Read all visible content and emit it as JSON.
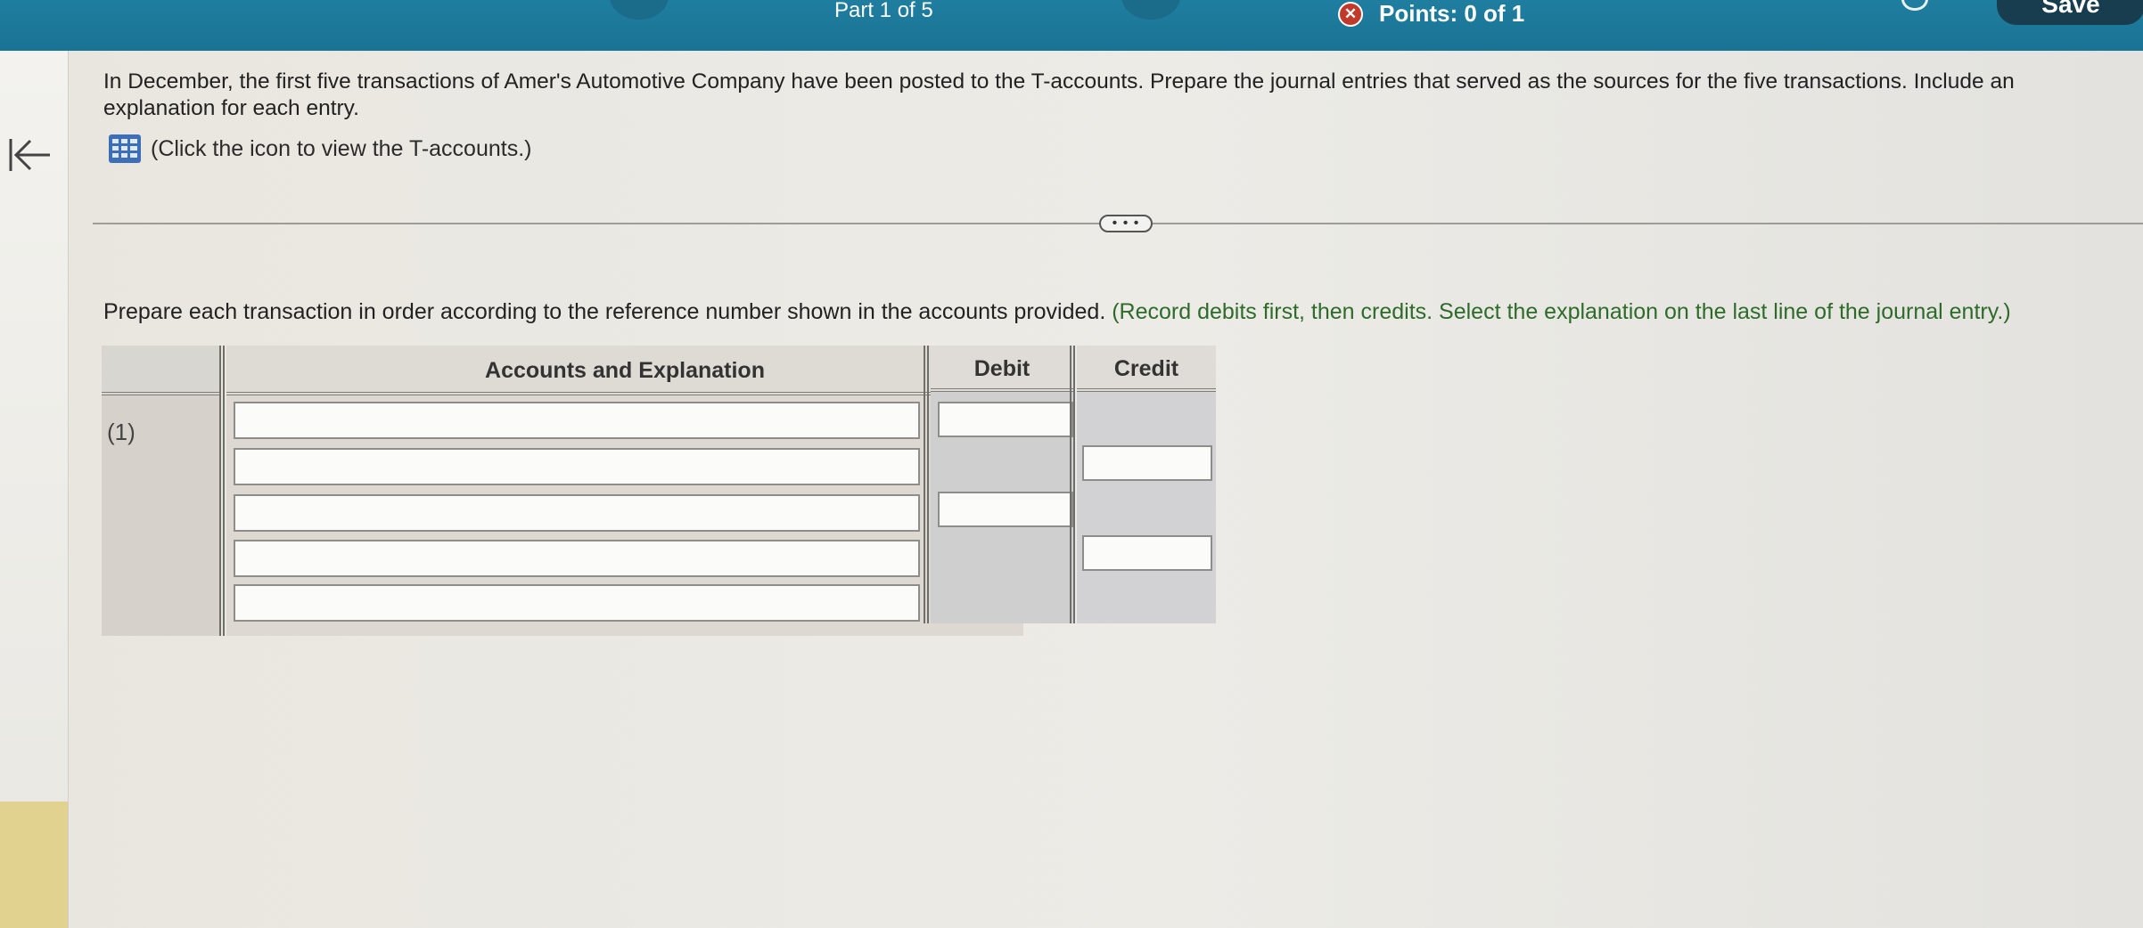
{
  "topbar": {
    "part_label": "Part 1 of 5",
    "points_label": "Points: 0 of 1",
    "save_label": "Save",
    "colors": {
      "bar": "#1f7ea0",
      "save_button": "#173d4f",
      "error_icon": "#c0392b"
    }
  },
  "question": {
    "text": "In December, the first five transactions of Amer's Automotive Company have been posted to the T-accounts. Prepare the journal entries that served as the sources for the five transactions. Include an explanation for each entry.",
    "link_text": "(Click the icon to view the T-accounts.)",
    "more_label": "• • •"
  },
  "instructions": {
    "main": "Prepare each transaction in order according to the reference number shown in the accounts provided.",
    "hint": "(Record debits first, then credits. Select the explanation on the last line of the journal entry.)"
  },
  "journal": {
    "headers": {
      "accounts": "Accounts and Explanation",
      "debit": "Debit",
      "credit": "Credit"
    },
    "entry_ref": "(1)",
    "account_rows": [
      "",
      "",
      "",
      "",
      ""
    ],
    "debit_inputs": [
      "",
      ""
    ],
    "credit_inputs": [
      "",
      ""
    ]
  },
  "icons": {
    "collapse": "arrow-left-bar-icon",
    "t_accounts": "grid-table-icon",
    "error": "x-circle-icon"
  }
}
